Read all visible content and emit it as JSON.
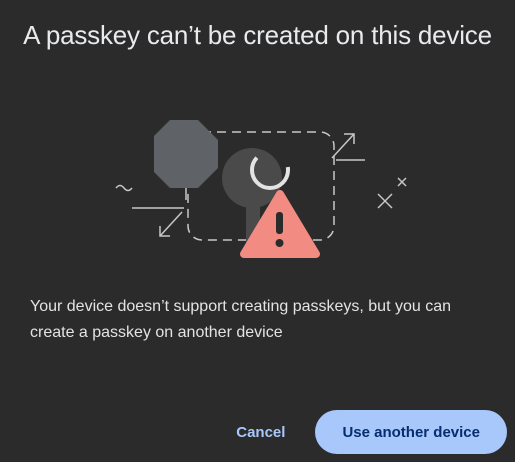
{
  "dialog": {
    "title": "A passkey can’t be created on this device",
    "message": "Your device doesn’t support creating passkeys, but you can create a passkey on another device",
    "illustration": "passkey-error-illustration",
    "buttons": {
      "cancel_label": "Cancel",
      "primary_label": "Use another device"
    }
  },
  "colors": {
    "background": "#2b2b2b",
    "accent": "#a8c7fa",
    "warning": "#f28b82"
  }
}
